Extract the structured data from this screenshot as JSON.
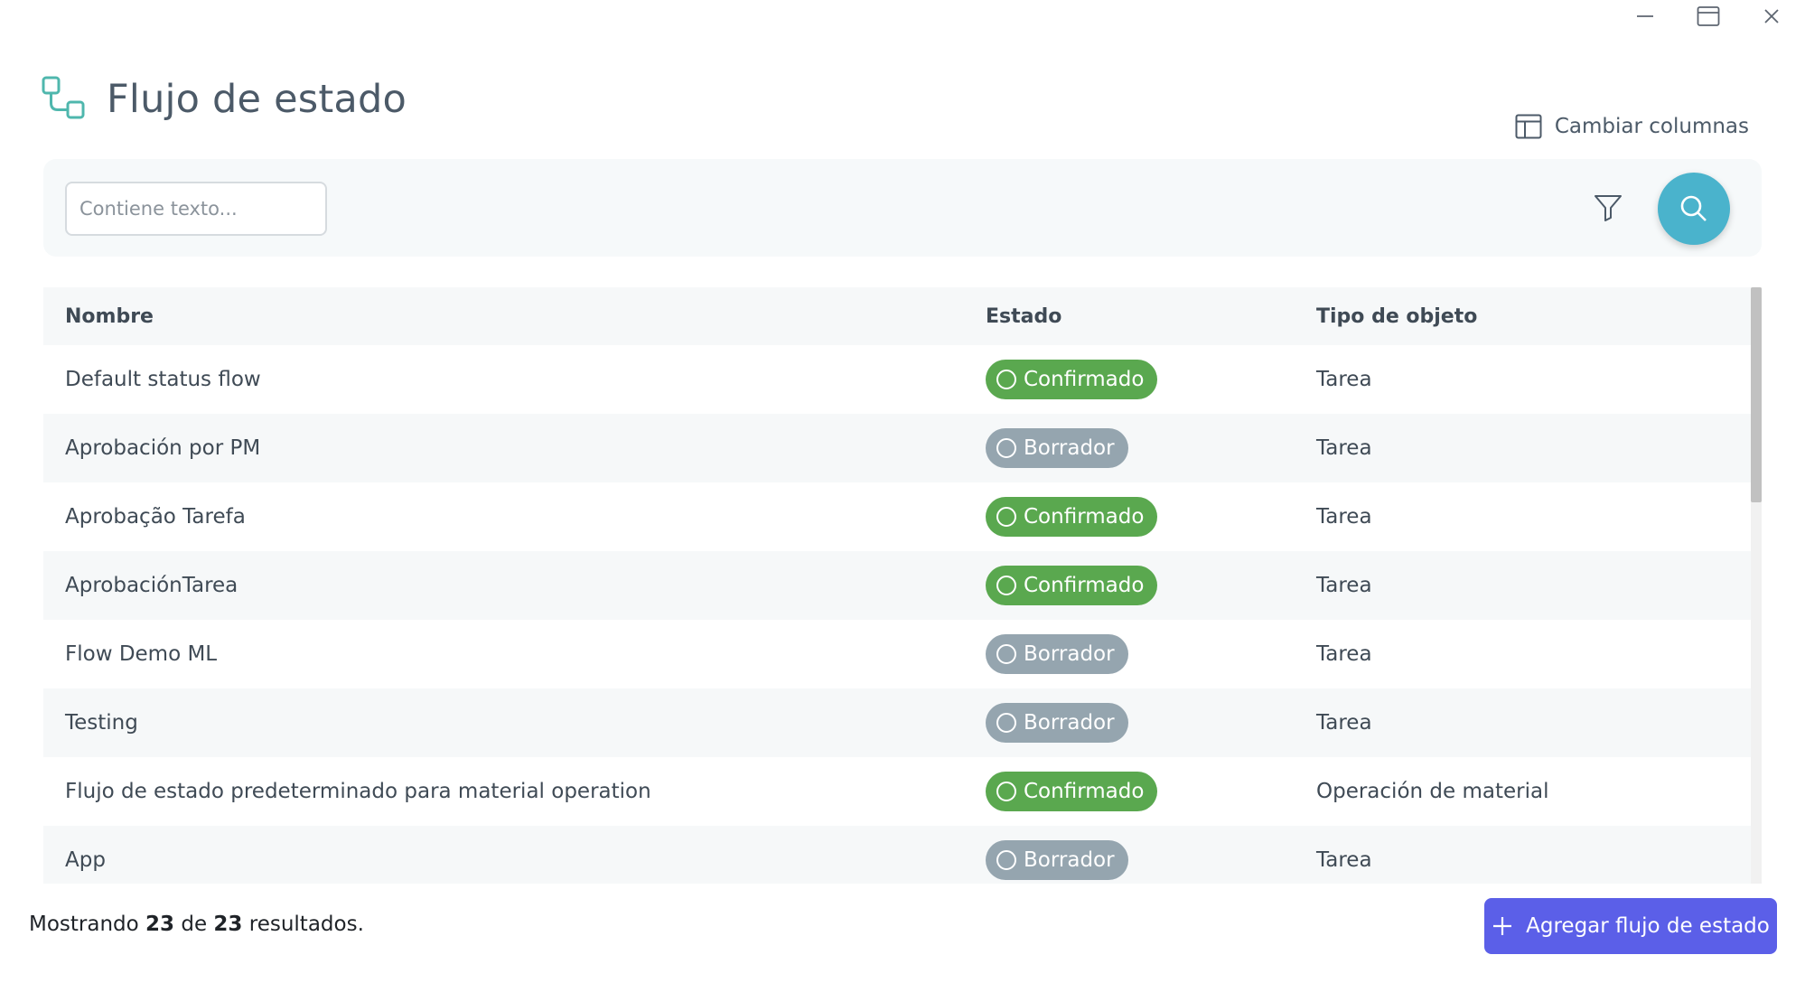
{
  "window": {
    "controls": [
      "minimize-icon",
      "maximize-icon",
      "close-icon"
    ]
  },
  "header": {
    "title": "Flujo de estado",
    "icon": "status-flow-icon"
  },
  "toolbar": {
    "change_columns_label": "Cambiar columnas",
    "search_placeholder": "Contiene texto...",
    "search_value": "",
    "filter_icon": "filter-icon",
    "search_icon": "search-icon"
  },
  "table": {
    "columns": [
      "Nombre",
      "Estado",
      "Tipo de objeto"
    ],
    "rows": [
      {
        "name": "Default status flow",
        "status": "Confirmado",
        "type": "Tarea"
      },
      {
        "name": "Aprobación por PM",
        "status": "Borrador",
        "type": "Tarea"
      },
      {
        "name": "Aprobação Tarefa",
        "status": "Confirmado",
        "type": "Tarea"
      },
      {
        "name": "AprobaciónTarea",
        "status": "Confirmado",
        "type": "Tarea"
      },
      {
        "name": "Flow Demo ML",
        "status": "Borrador",
        "type": "Tarea"
      },
      {
        "name": "Testing",
        "status": "Borrador",
        "type": "Tarea"
      },
      {
        "name": "Flujo de estado predeterminado para material operation",
        "status": "Confirmado",
        "type": "Operación de material"
      },
      {
        "name": "App",
        "status": "Borrador",
        "type": "Tarea"
      }
    ]
  },
  "footer": {
    "prefix": "Mostrando",
    "shown": "23",
    "middle": "de",
    "total": "23",
    "suffix": "resultados.",
    "add_button_label": "Agregar flujo de estado"
  },
  "colors": {
    "accent": "#4ab3cc",
    "primary_button": "#5b5fe8",
    "confirmed": "#5aa84f",
    "draft": "#95a5af",
    "brand_icon": "#4fb7ad"
  }
}
